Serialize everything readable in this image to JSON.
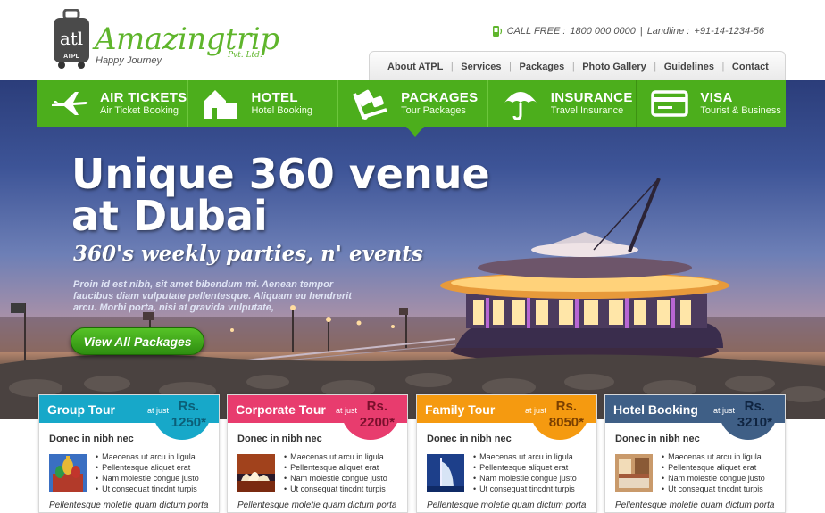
{
  "brand": {
    "monogram": "atl",
    "name": "Amazingtrip",
    "legal": "Pvt. Ltd.",
    "tagline": "Happy Journey",
    "badge": "ATPL",
    "green": "#5fb52c"
  },
  "contact": {
    "call_label": "CALL FREE :",
    "call_number": "1800 000 0000",
    "divider": "|",
    "landline_label": "Landline :",
    "landline_number": "+91-14-1234-56"
  },
  "topnav": {
    "items": [
      "About ATPL",
      "Services",
      "Packages",
      "Photo Gallery",
      "Guidelines",
      "Contact"
    ],
    "separator": "|"
  },
  "services": [
    {
      "title": "AIR TICKETS",
      "subtitle": "Air Ticket Booking",
      "icon": "airplane-icon"
    },
    {
      "title": "HOTEL",
      "subtitle": "Hotel Booking",
      "icon": "building-icon"
    },
    {
      "title": "PACKAGES",
      "subtitle": "Tour Packages",
      "icon": "luggage-cart-icon"
    },
    {
      "title": "INSURANCE",
      "subtitle": "Travel Insurance",
      "icon": "umbrella-icon"
    },
    {
      "title": "VISA",
      "subtitle": "Tourist & Business",
      "icon": "card-icon"
    }
  ],
  "services_color": "#4cae1c",
  "hero": {
    "headline_line1": "Unique 360 venue",
    "headline_line2": "at Dubai",
    "subhead": "360's weekly parties, n' events",
    "paragraph": "Proin id est nibh, sit amet bibendum mi. Aenean tempor faucibus diam vulputate pellentesque. Aliquam eu hendrerit arcu. Morbi porta, nisi at gravida vulputate,",
    "cta": "View All Packages"
  },
  "cards": [
    {
      "title": "Group Tour",
      "price_label": "at just",
      "currency": "Rs.",
      "price": "1250*",
      "color": "#17a8c9",
      "price_color": "#0b5e77",
      "subtitle": "Donec in nibh nec",
      "image": "kremlin-image",
      "bullets": [
        "Maecenas ut arcu in ligula",
        "Pellentesque aliquet erat",
        "Nam molestie congue justo",
        "Ut consequat tincdnt turpis"
      ],
      "footer": "Pellentesque moletie quam dictum porta"
    },
    {
      "title": "Corporate Tour",
      "price_label": "at just",
      "currency": "Rs.",
      "price": "2200*",
      "color": "#e83c6e",
      "price_color": "#7a0f2c",
      "subtitle": "Donec in nibh nec",
      "image": "opera-house-image",
      "bullets": [
        "Maecenas ut arcu in ligula",
        "Pellentesque aliquet erat",
        "Nam molestie congue justo",
        "Ut consequat tincdnt turpis"
      ],
      "footer": "Pellentesque moletie quam dictum porta"
    },
    {
      "title": "Family Tour",
      "price_label": "at just",
      "currency": "Rs.",
      "price": "8050*",
      "color": "#f59a10",
      "price_color": "#7a3f00",
      "subtitle": "Donec in nibh nec",
      "image": "burj-al-arab-image",
      "bullets": [
        "Maecenas ut arcu in ligula",
        "Pellentesque aliquet erat",
        "Nam molestie congue justo",
        "Ut consequat tincdnt turpis"
      ],
      "footer": "Pellentesque moletie quam dictum porta"
    },
    {
      "title": "Hotel Booking",
      "price_label": "at just",
      "currency": "Rs.",
      "price": "3210*",
      "color": "#3f5f86",
      "price_color": "#0f2440",
      "subtitle": "Donec in nibh nec",
      "image": "hotel-room-image",
      "bullets": [
        "Maecenas ut arcu in ligula",
        "Pellentesque aliquet erat",
        "Nam molestie congue justo",
        "Ut consequat tincdnt turpis"
      ],
      "footer": "Pellentesque moletie quam dictum porta"
    }
  ]
}
